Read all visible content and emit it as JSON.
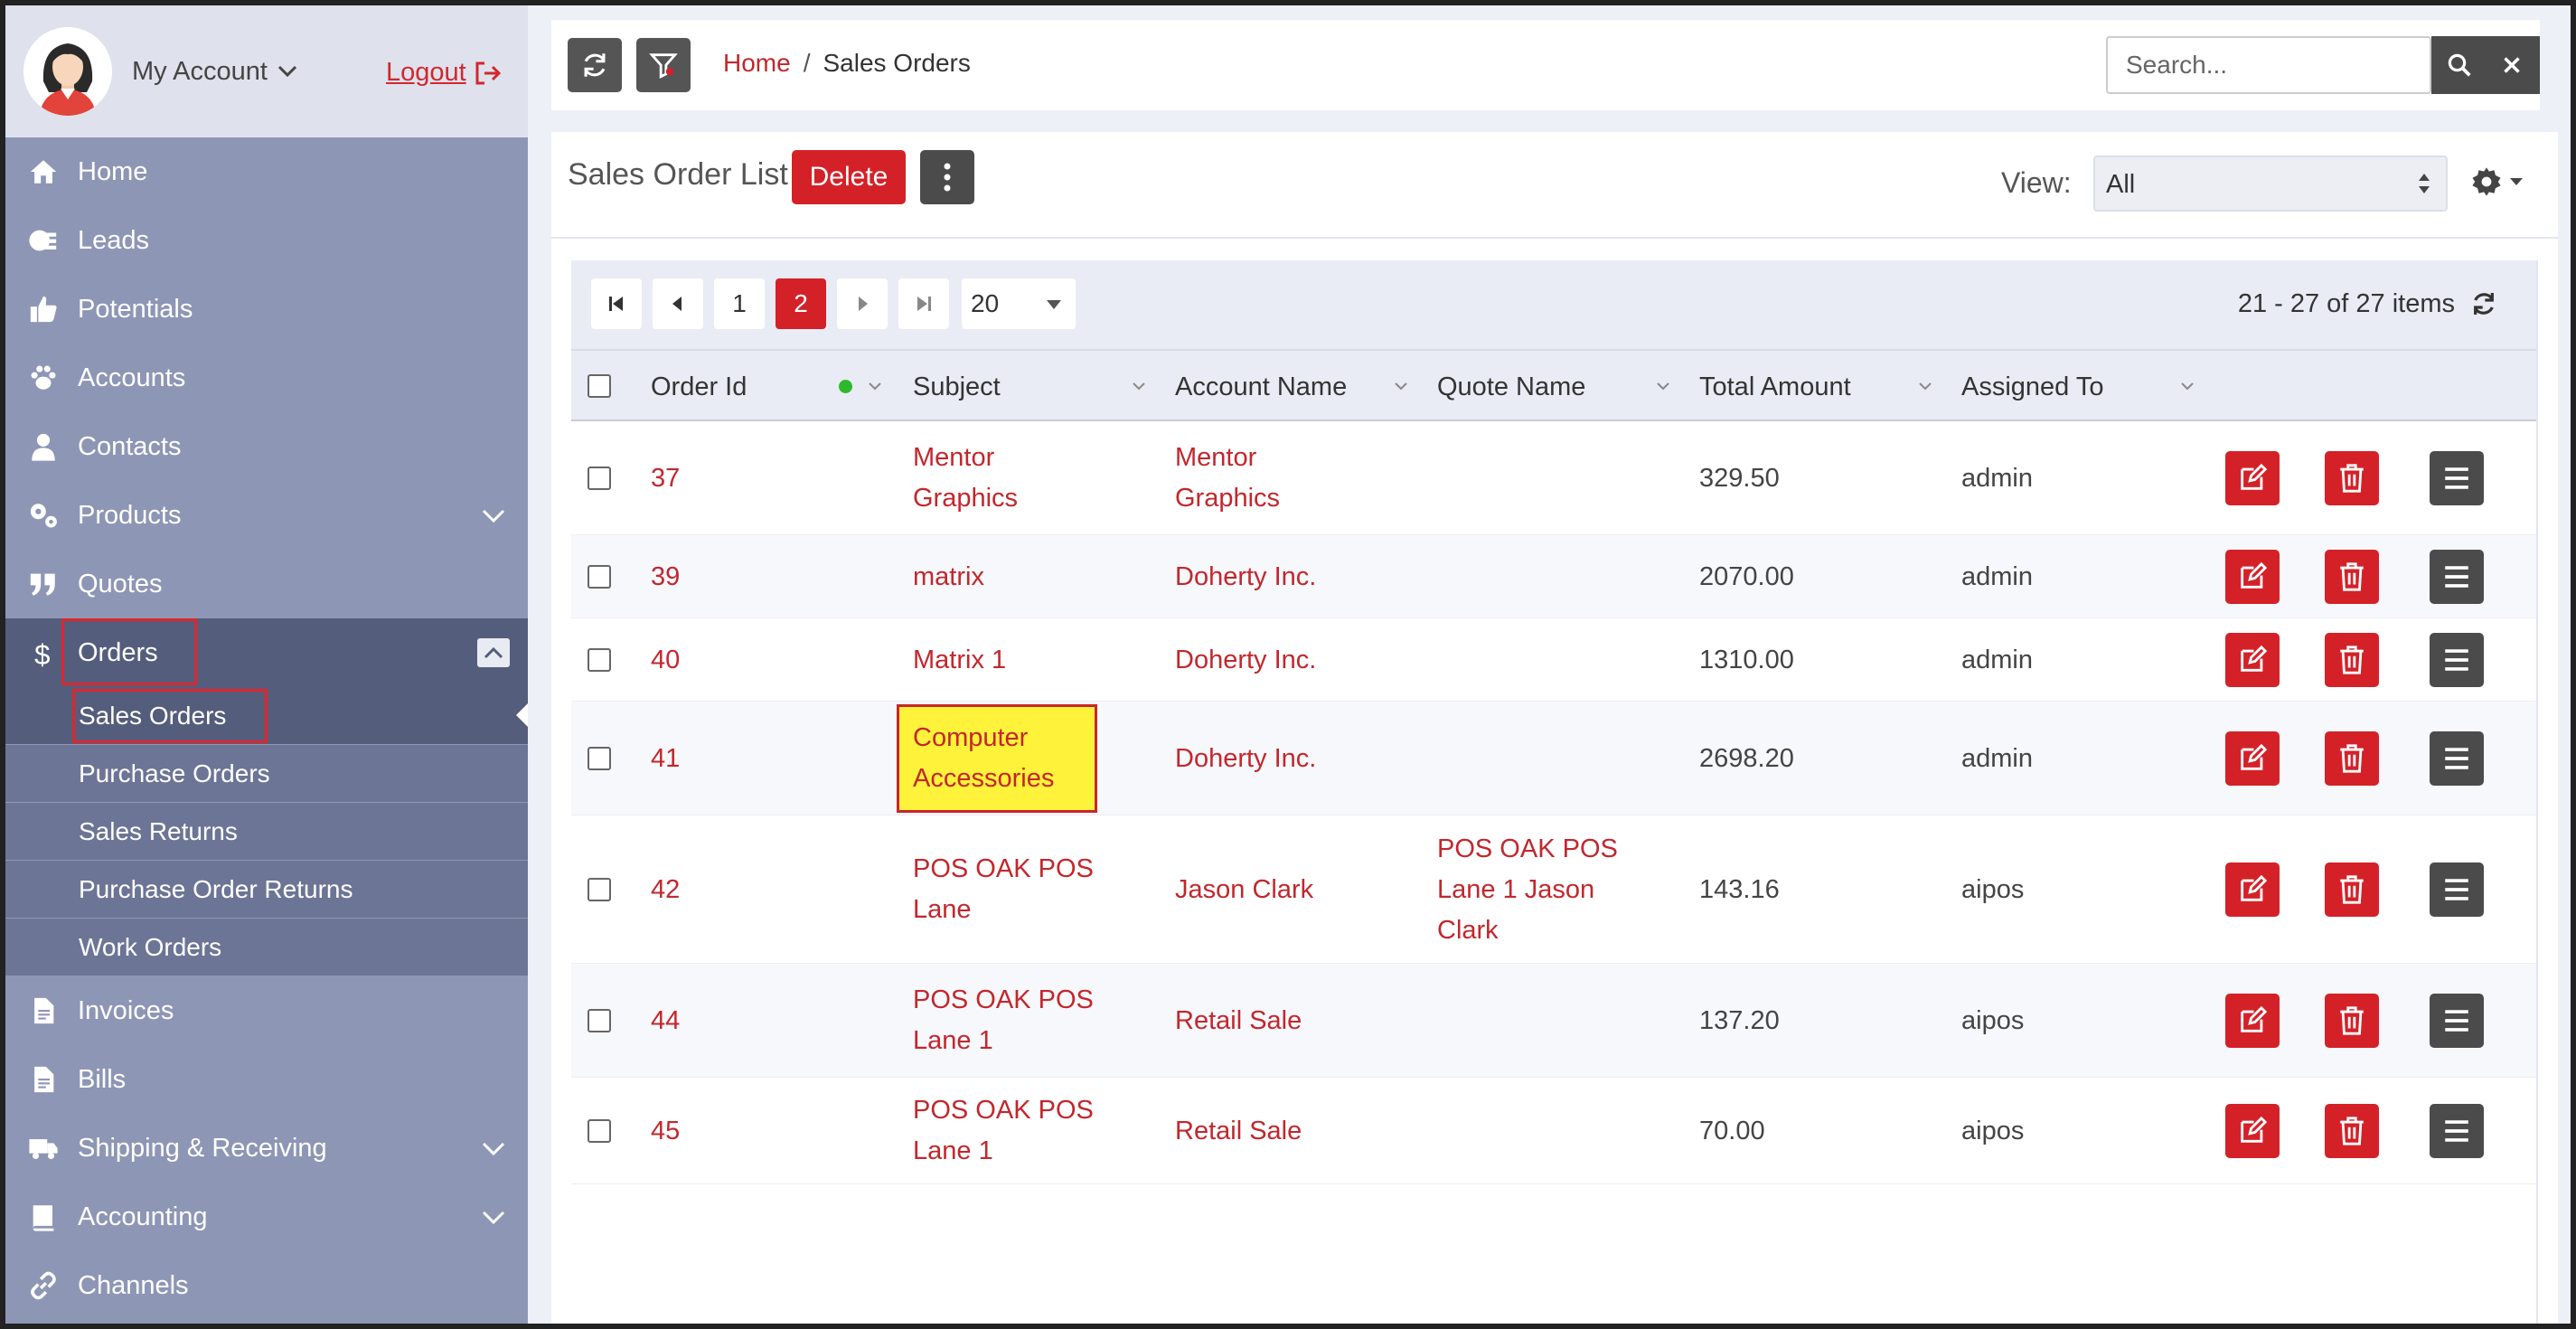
{
  "account": {
    "name": "My Account",
    "logout": "Logout"
  },
  "nav": {
    "home": "Home",
    "leads": "Leads",
    "potentials": "Potentials",
    "accounts": "Accounts",
    "contacts": "Contacts",
    "products": "Products",
    "quotes": "Quotes",
    "orders": "Orders",
    "orders_sub": [
      "Sales Orders",
      "Purchase Orders",
      "Sales Returns",
      "Purchase Order Returns",
      "Work Orders"
    ],
    "invoices": "Invoices",
    "bills": "Bills",
    "shipping": "Shipping & Receiving",
    "accounting": "Accounting",
    "channels": "Channels"
  },
  "breadcrumb": {
    "home": "Home",
    "sep": "/",
    "current": "Sales Orders"
  },
  "search": {
    "placeholder": "Search..."
  },
  "panel": {
    "title": "Sales Order List",
    "delete": "Delete",
    "view_label": "View:",
    "view_value": "All"
  },
  "pager": {
    "pages": [
      "1",
      "2"
    ],
    "current": "2",
    "page_size": "20",
    "info": "21 - 27 of 27 items"
  },
  "columns": {
    "order_id": "Order Id",
    "subject": "Subject",
    "account": "Account Name",
    "quote": "Quote Name",
    "total": "Total Amount",
    "assigned": "Assigned To"
  },
  "rows": [
    {
      "id": "37",
      "subject": [
        "Mentor",
        "Graphics"
      ],
      "account": [
        "Mentor",
        "Graphics"
      ],
      "quote": [],
      "total": "329.50",
      "assigned": "admin"
    },
    {
      "id": "39",
      "subject": [
        "matrix"
      ],
      "account": [
        "Doherty Inc."
      ],
      "quote": [],
      "total": "2070.00",
      "assigned": "admin"
    },
    {
      "id": "40",
      "subject": [
        "Matrix 1"
      ],
      "account": [
        "Doherty Inc."
      ],
      "quote": [],
      "total": "1310.00",
      "assigned": "admin"
    },
    {
      "id": "41",
      "subject": [
        "Computer",
        "Accessories"
      ],
      "account": [
        "Doherty Inc."
      ],
      "quote": [],
      "total": "2698.20",
      "assigned": "admin"
    },
    {
      "id": "42",
      "subject": [
        "POS OAK POS",
        "Lane"
      ],
      "account": [
        "Jason Clark"
      ],
      "quote": [
        "POS OAK POS",
        "Lane 1 Jason",
        "Clark"
      ],
      "total": "143.16",
      "assigned": "aipos"
    },
    {
      "id": "44",
      "subject": [
        "POS OAK POS",
        "Lane 1"
      ],
      "account": [
        "Retail Sale"
      ],
      "quote": [],
      "total": "137.20",
      "assigned": "aipos"
    },
    {
      "id": "45",
      "subject": [
        "POS OAK POS",
        "Lane 1"
      ],
      "account": [
        "Retail Sale"
      ],
      "quote": [],
      "total": "70.00",
      "assigned": "aipos"
    }
  ],
  "colors": {
    "accent_red": "#d42128",
    "sidebar": "#8e96b5",
    "sidebar_active": "#555d7c",
    "highlight": "#fff23a",
    "status_dot": "#2eb82e"
  },
  "icons": [
    "refresh-icon",
    "filter-icon",
    "search-icon",
    "close-icon",
    "kebab-icon",
    "gear-icon",
    "edit-icon",
    "trash-icon",
    "menu-icon"
  ]
}
